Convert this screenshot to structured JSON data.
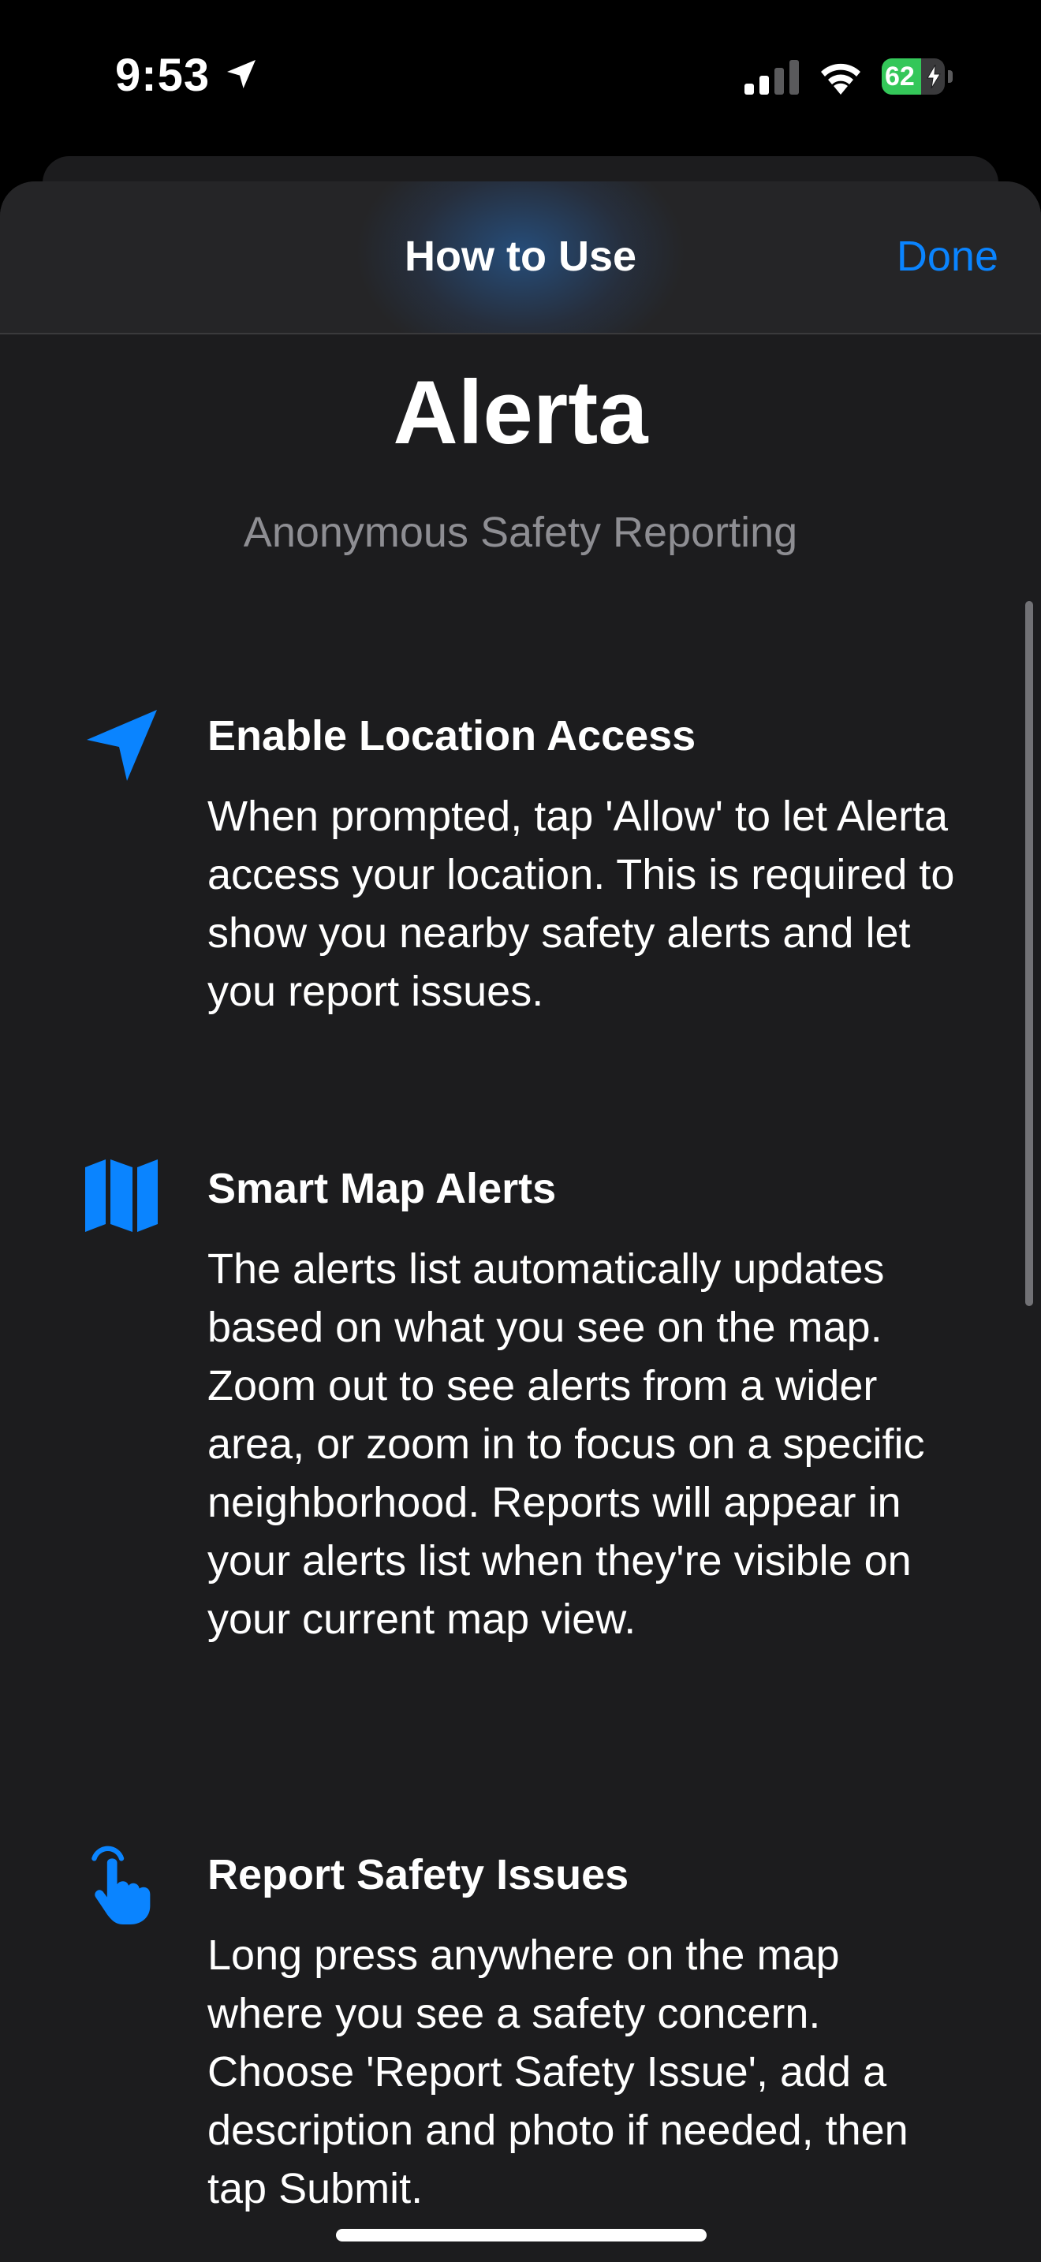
{
  "status_bar": {
    "time": "9:53",
    "battery_percent": "62",
    "battery_level": 0.62,
    "charging": true
  },
  "nav": {
    "title": "How to Use",
    "done_label": "Done"
  },
  "header": {
    "app_name": "Alerta",
    "tagline": "Anonymous Safety Reporting"
  },
  "sections": [
    {
      "icon": "location-arrow-icon",
      "title": "Enable Location Access",
      "body": "When prompted, tap 'Allow' to let Alerta access your location. This is required to show you nearby safety alerts and let you report issues."
    },
    {
      "icon": "map-icon",
      "title": "Smart Map Alerts",
      "body": "The alerts list automatically updates based on what you see on the map. Zoom out to see alerts from a wider area, or zoom in to focus on a specific neighborhood. Reports will appear in your alerts list when they're visible on your current map view."
    },
    {
      "icon": "hand-tap-icon",
      "title": "Report Safety Issues",
      "body": "Long press anywhere on the map where you see a safety concern. Choose 'Report Safety Issue', add a description and photo if needed, then tap Submit."
    }
  ],
  "colors": {
    "accent": "#0a84ff",
    "sheet_background": "#1c1c1e",
    "secondary_text": "#8e8e93",
    "battery_green": "#34c759"
  }
}
